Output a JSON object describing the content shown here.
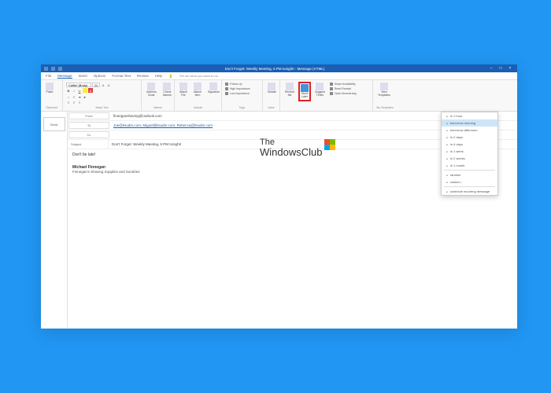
{
  "titlebar": {
    "title": "Don't Forget: Weekly Meeting, 6 PM tonight! - Message (HTML)"
  },
  "tabs": {
    "file": "File",
    "message": "Message",
    "insert": "Insert",
    "options": "Options",
    "format_text": "Format Text",
    "review": "Review",
    "help": "Help",
    "tell_me": "Tell me what you want to do"
  },
  "ribbon": {
    "clipboard": {
      "label": "Clipboard",
      "paste": "Paste"
    },
    "font": {
      "label": "Basic Text",
      "family": "Calibri (Body)",
      "size": "11"
    },
    "names": {
      "label": "Names",
      "address": "Address\nBook",
      "check": "Check\nNames"
    },
    "include": {
      "label": "Include",
      "attach_file": "Attach\nFile",
      "attach_item": "Attach\nItem",
      "signature": "Signature"
    },
    "tags": {
      "label": "Tags",
      "follow": "Follow Up",
      "high": "High Importance",
      "low": "Low Importance"
    },
    "voice": {
      "label": "Voice",
      "dictate": "Dictate"
    },
    "boomerang": {
      "remind": "Remind\nMe",
      "send_later": "Send\nLater",
      "suggest": "Suggest\nTimes",
      "share_avail": "Share Availability",
      "read_receipt": "Read Receipt",
      "open_boom": "Open Boomerang"
    },
    "templates": {
      "label": "My Templates",
      "view": "View\nTemplates"
    }
  },
  "fields": {
    "from_label": "From",
    "from_value": "finneganshaving@outlook.com",
    "to_label": "To",
    "to_value": "Joe@ksudm.com; Miguel@ksudm.com; Rebecca@ksudm.com",
    "cc_label": "Cc",
    "subject_label": "Subject",
    "subject_value": "Don't Forget: Weekly Meeting, 6 PM tonight!",
    "send": "Send"
  },
  "body": {
    "line1": "Don't be late!",
    "sig_name": "Michael Finnegan",
    "sig_company": "Finnegan's Shaving Supplies and Sundries"
  },
  "dropdown": {
    "items": [
      "in 1 hour",
      "tomorrow morning",
      "tomorrow afternoon",
      "in 2 days",
      "in 4 days",
      "in 1 week",
      "in 2 weeks",
      "in 1 month",
      "random",
      "custom...",
      "schedule recurring message"
    ]
  },
  "watermark": {
    "the": "The",
    "wc": "WindowsClub"
  }
}
